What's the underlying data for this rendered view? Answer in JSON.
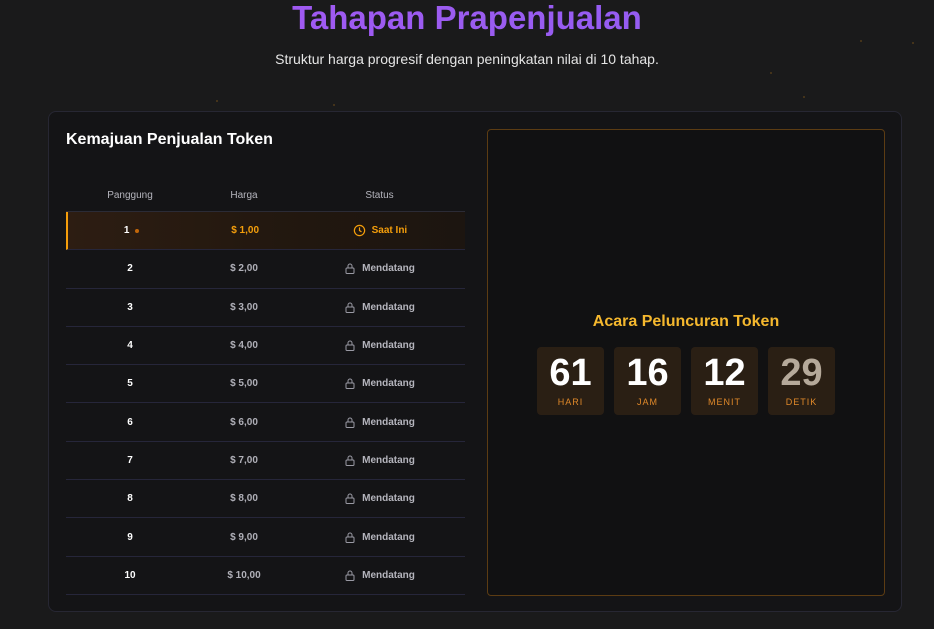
{
  "header": {
    "title": "Tahapan Prapenjualan",
    "subtitle": "Struktur harga progresif dengan peningkatan nilai di 10 tahap."
  },
  "progress": {
    "title": "Kemajuan Penjualan Token",
    "columns": [
      "Panggung",
      "Harga",
      "Status"
    ],
    "rows": [
      {
        "stage": "1",
        "price": "$ 1,00",
        "status": "Saat Ini",
        "icon": "clock-icon"
      },
      {
        "stage": "2",
        "price": "$ 2,00",
        "status": "Mendatang",
        "icon": "lock-icon"
      },
      {
        "stage": "3",
        "price": "$ 3,00",
        "status": "Mendatang",
        "icon": "lock-icon"
      },
      {
        "stage": "4",
        "price": "$ 4,00",
        "status": "Mendatang",
        "icon": "lock-icon"
      },
      {
        "stage": "5",
        "price": "$ 5,00",
        "status": "Mendatang",
        "icon": "lock-icon"
      },
      {
        "stage": "6",
        "price": "$ 6,00",
        "status": "Mendatang",
        "icon": "lock-icon"
      },
      {
        "stage": "7",
        "price": "$ 7,00",
        "status": "Mendatang",
        "icon": "lock-icon"
      },
      {
        "stage": "8",
        "price": "$ 8,00",
        "status": "Mendatang",
        "icon": "lock-icon"
      },
      {
        "stage": "9",
        "price": "$ 9,00",
        "status": "Mendatang",
        "icon": "lock-icon"
      },
      {
        "stage": "10",
        "price": "$ 10,00",
        "status": "Mendatang",
        "icon": "lock-icon"
      }
    ]
  },
  "launch": {
    "title": "Acara Peluncuran Token",
    "countdown": [
      {
        "value": "61",
        "label": "HARI"
      },
      {
        "value": "16",
        "label": "JAM"
      },
      {
        "value": "12",
        "label": "MENIT"
      },
      {
        "value": "29",
        "label": "DETIK"
      }
    ]
  },
  "colors": {
    "accent": "#f59e0b",
    "title_gradient": "#a855f7",
    "launch_title": "#f5b82e"
  }
}
